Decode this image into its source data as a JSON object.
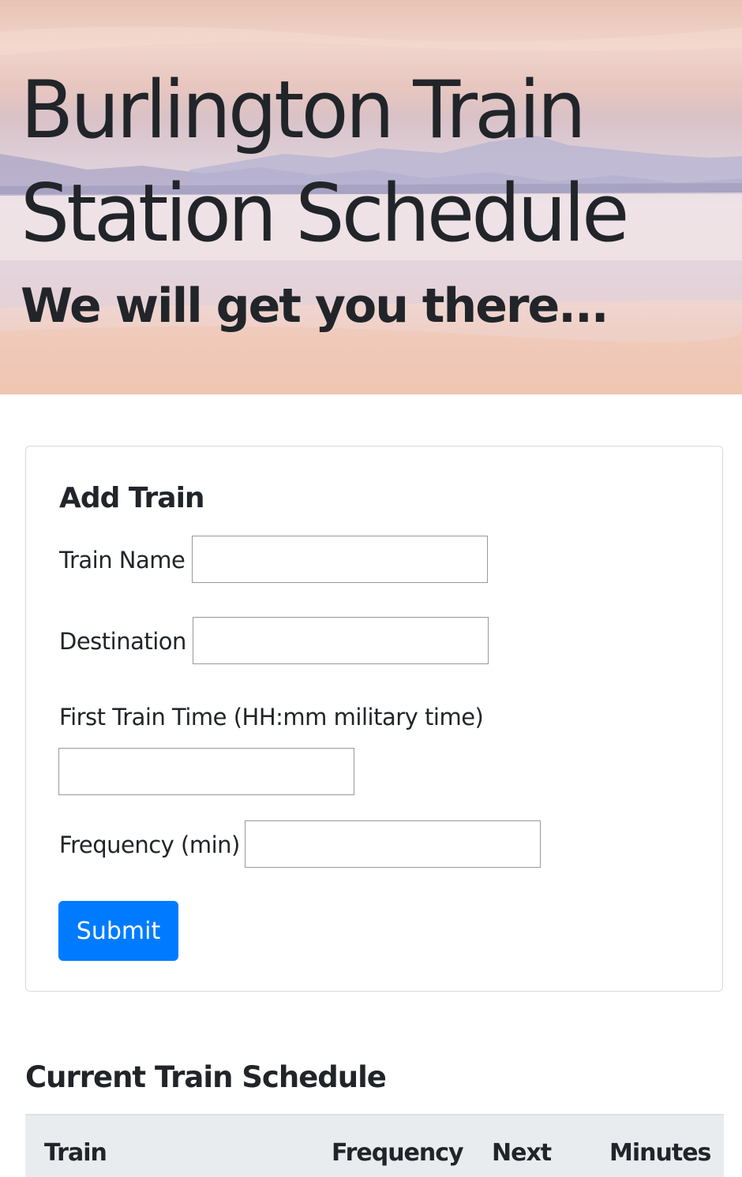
{
  "hero": {
    "title": "Burlington Train Station Schedule",
    "subtitle": "We will get you there..."
  },
  "form": {
    "heading": "Add Train",
    "train_name_label": "Train Name",
    "train_name_value": "",
    "destination_label": "Destination",
    "destination_value": "",
    "first_time_label": "First Train Time (HH:mm military time)",
    "first_time_value": "",
    "frequency_label": "Frequency (min)",
    "frequency_value": "",
    "submit_label": "Submit"
  },
  "schedule": {
    "heading": "Current Train Schedule",
    "columns": [
      "Train",
      "Frequency",
      "Next",
      "Minutes"
    ]
  },
  "colors": {
    "primary": "#007bff",
    "text": "#212529",
    "table_head_bg": "#e9ecef"
  }
}
